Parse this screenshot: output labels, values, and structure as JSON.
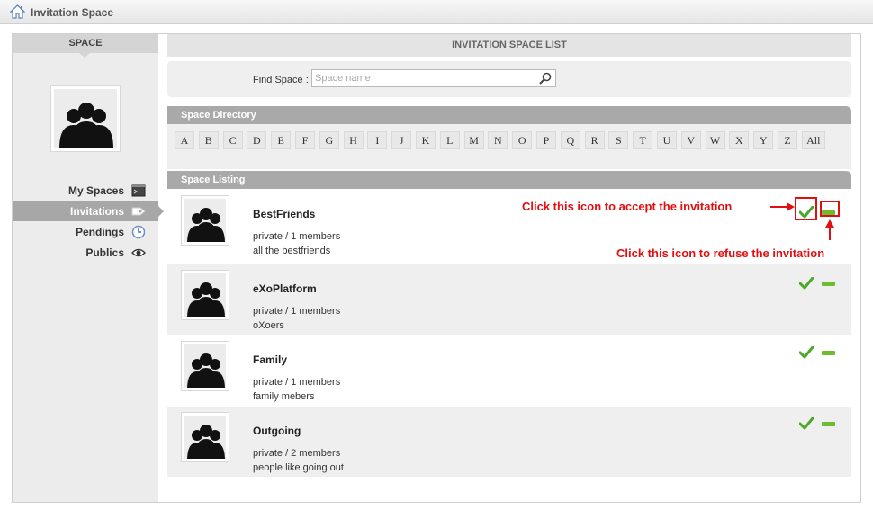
{
  "window": {
    "title": "Invitation Space"
  },
  "sidebar": {
    "heading": "SPACE",
    "items": [
      {
        "label": "My Spaces",
        "icon": "terminal-icon"
      },
      {
        "label": "Invitations",
        "icon": "tag-icon",
        "active": true
      },
      {
        "label": "Pendings",
        "icon": "clock-icon"
      },
      {
        "label": "Publics",
        "icon": "eye-icon"
      }
    ]
  },
  "main": {
    "header": "INVITATION SPACE LIST",
    "search": {
      "label": "Find Space :",
      "placeholder": "Space name"
    },
    "directory": {
      "title": "Space Directory",
      "letters": [
        "A",
        "B",
        "C",
        "D",
        "E",
        "F",
        "G",
        "H",
        "I",
        "J",
        "K",
        "L",
        "M",
        "N",
        "O",
        "P",
        "Q",
        "R",
        "S",
        "T",
        "U",
        "V",
        "W",
        "X",
        "Y",
        "Z",
        "All"
      ]
    },
    "listing": {
      "title": "Space Listing",
      "spaces": [
        {
          "name": "BestFriends",
          "meta": "private / 1 members",
          "description": "all the bestfriends"
        },
        {
          "name": "eXoPlatform",
          "meta": "private / 1 members",
          "description": "oXoers"
        },
        {
          "name": "Family",
          "meta": "private / 1 members",
          "description": "family mebers"
        },
        {
          "name": "Outgoing",
          "meta": "private / 2 members",
          "description": "people like going out"
        }
      ]
    }
  },
  "annotations": {
    "accept": "Click this icon to accept the invitation",
    "refuse": "Click this icon to refuse the invitation"
  },
  "colors": {
    "accent_red": "#e01010",
    "accept_green": "#4aa82a",
    "bar_gray": "#a9a9a9"
  }
}
